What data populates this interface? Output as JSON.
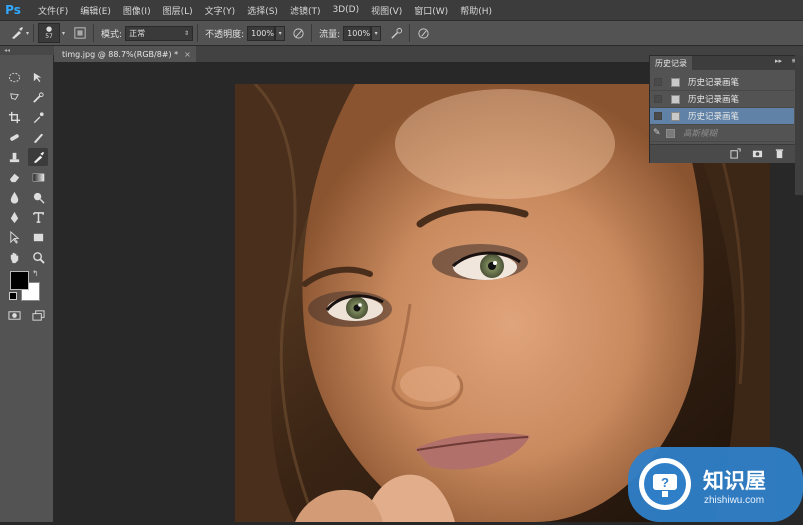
{
  "app": {
    "logo": "Ps"
  },
  "menu": [
    "文件(F)",
    "编辑(E)",
    "图像(I)",
    "图层(L)",
    "文字(Y)",
    "选择(S)",
    "滤镜(T)",
    "3D(D)",
    "视图(V)",
    "窗口(W)",
    "帮助(H)"
  ],
  "options": {
    "brush_size": "57",
    "mode_label": "模式:",
    "mode_value": "正常",
    "opacity_label": "不透明度:",
    "opacity_value": "100%",
    "flow_label": "流量:",
    "flow_value": "100%"
  },
  "document_tab": {
    "title": "timg.jpg @ 88.7%(RGB/8#) *",
    "close": "×"
  },
  "history_panel": {
    "title": "历史记录",
    "collapse": "▸▸",
    "menu": "≡",
    "items": [
      {
        "label": "历史记录画笔",
        "state": "normal"
      },
      {
        "label": "历史记录画笔",
        "state": "normal"
      },
      {
        "label": "历史记录画笔",
        "state": "selected"
      },
      {
        "label": "高斯模糊",
        "state": "dimmed"
      }
    ]
  },
  "watermark": {
    "name": "知识屋",
    "url": "zhishiwu.com"
  },
  "colors": {
    "accent": "#31a8ff",
    "selection": "#6082a6",
    "panel": "#535353",
    "workspace": "#282828"
  }
}
